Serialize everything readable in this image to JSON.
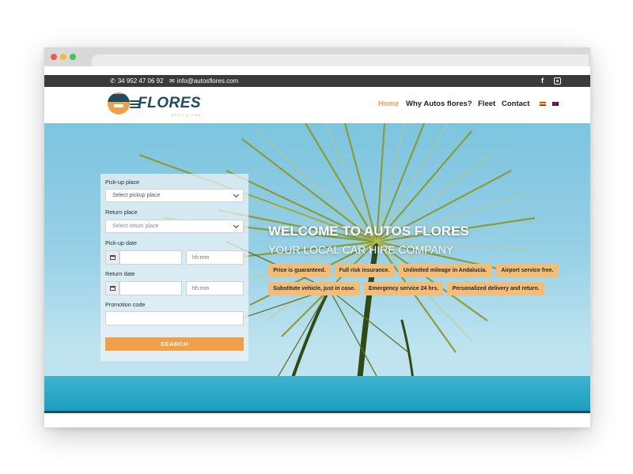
{
  "topbar": {
    "phone": "34 952 47 06 92",
    "email": "info@autosflores.com",
    "social": [
      "facebook-icon",
      "instagram-icon"
    ]
  },
  "header": {
    "logo_text": "FLORES",
    "logo_subtext": "RENT A CAR",
    "nav": [
      {
        "label": "Home",
        "active": true
      },
      {
        "label": "Why Autos flores?",
        "active": false
      },
      {
        "label": "Fleet",
        "active": false
      },
      {
        "label": "Contact",
        "active": false
      }
    ],
    "languages": [
      "es-flag-icon",
      "en-flag-icon"
    ]
  },
  "form": {
    "pickup_place_label": "Pick-up place",
    "pickup_place_value": "Select pickup place",
    "return_place_label": "Return place",
    "return_place_value": "Select return place",
    "pickup_date_label": "Pick-up date",
    "pickup_time_placeholder": "hh:mm",
    "return_date_label": "Return date",
    "return_time_placeholder": "hh:mm",
    "promo_label": "Promotion code",
    "search_label": "SEARCH"
  },
  "hero": {
    "title": "WELCOME TO AUTOS FLORES",
    "subtitle": "YOUR LOCAL CAR HIRE COMPANY",
    "badges": [
      "Price is guaranteed.",
      "Full risk insurance.",
      "Unlimited mileage in Andalucia.",
      "Airport service free.",
      "Substitute vehicle, just in case.",
      "Emergency service 24 hrs.",
      "Personalized delivery and return."
    ]
  },
  "colors": {
    "accent": "#f0a04a",
    "brand_dark": "#1f4c60",
    "topbar": "#3a3a3a",
    "badge": "#f3bd77"
  }
}
